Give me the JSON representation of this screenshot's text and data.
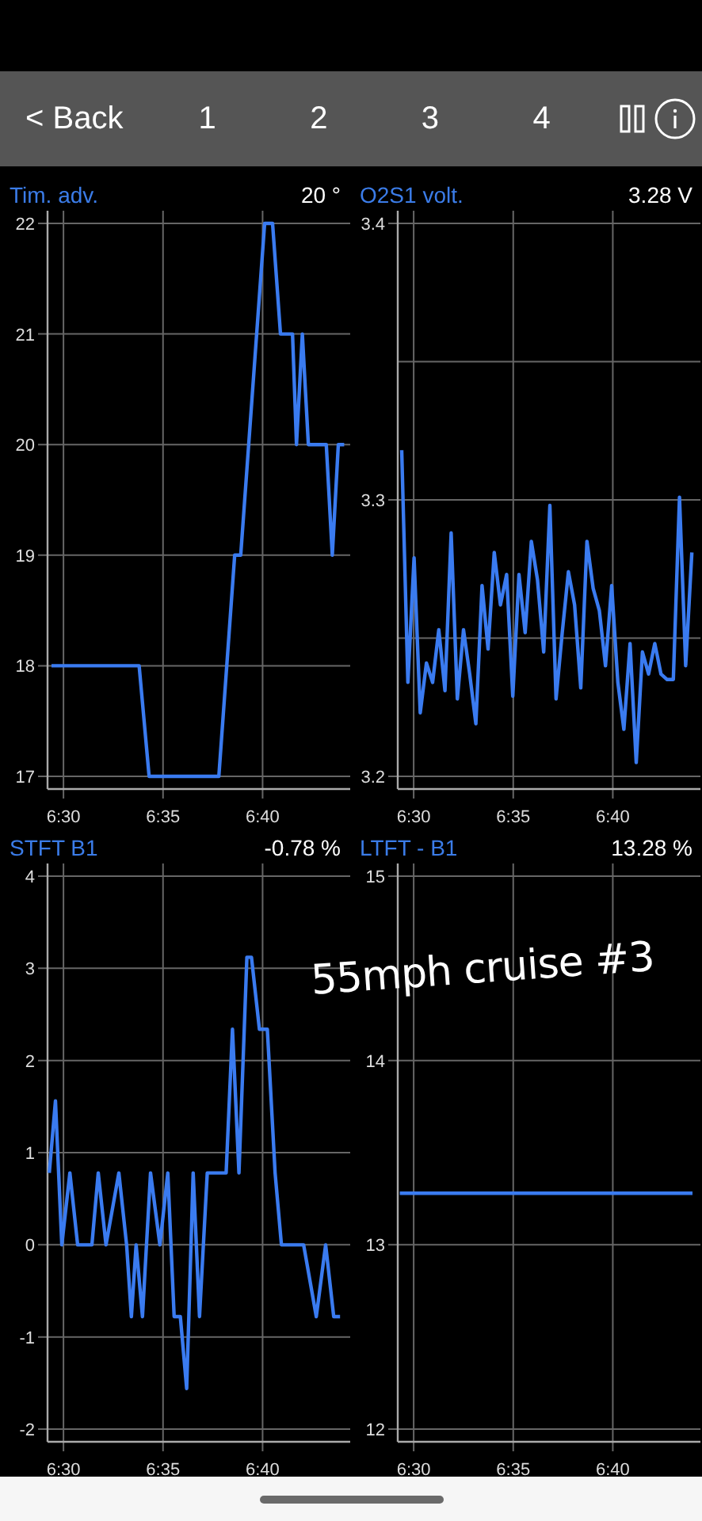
{
  "toolbar": {
    "back": "< Back",
    "pages": [
      "1",
      "2",
      "3",
      "4"
    ]
  },
  "panels": [
    {
      "title": "Tim. adv.",
      "reading": "20 °",
      "chart_data": {
        "type": "line",
        "x": [
          389.4,
          393.8,
          394.3,
          397.8,
          398.6,
          398.9,
          400.1,
          400.5,
          400.9,
          401.5,
          401.7,
          402.0,
          402.3,
          403.2,
          403.5,
          403.8,
          404.1
        ],
        "series": [
          {
            "color": "#3a7bf0",
            "values": [
              18,
              18,
              17,
              17,
              19,
              19,
              22,
              22,
              21,
              21,
              20,
              21,
              20,
              20,
              19,
              20,
              20
            ]
          }
        ],
        "grid": true,
        "xlim": [
          389.2,
          404.4
        ],
        "ylim": [
          17,
          22
        ],
        "xticks": [
          {
            "value": 390,
            "label": "6:30"
          },
          {
            "value": 395,
            "label": "6:35"
          },
          {
            "value": 400,
            "label": "6:40"
          }
        ],
        "yticks": [
          17,
          18,
          19,
          20,
          21,
          22
        ]
      }
    },
    {
      "title": "O2S1 volt.",
      "reading": "3.28 V",
      "chart_data": {
        "type": "line",
        "x": [
          389.4,
          389.71,
          390.02,
          390.33,
          390.64,
          390.95,
          391.26,
          391.57,
          391.88,
          392.19,
          392.5,
          392.81,
          393.12,
          393.43,
          393.74,
          394.05,
          394.36,
          394.67,
          394.98,
          395.29,
          395.6,
          395.91,
          396.22,
          396.53,
          396.84,
          397.15,
          397.46,
          397.77,
          398.08,
          398.39,
          398.7,
          399.01,
          399.32,
          399.63,
          399.94,
          400.25,
          400.56,
          400.87,
          401.18,
          401.49,
          401.8,
          402.11,
          402.42,
          402.73,
          403.04,
          403.35,
          403.66,
          403.97
        ],
        "series": [
          {
            "color": "#3a7bf0",
            "values": [
              3.318,
              3.234,
              3.279,
              3.223,
              3.241,
              3.234,
              3.253,
              3.231,
              3.288,
              3.228,
              3.253,
              3.237,
              3.219,
              3.269,
              3.246,
              3.281,
              3.262,
              3.273,
              3.229,
              3.273,
              3.252,
              3.285,
              3.271,
              3.245,
              3.298,
              3.228,
              3.252,
              3.274,
              3.262,
              3.232,
              3.285,
              3.268,
              3.26,
              3.24,
              3.269,
              3.234,
              3.217,
              3.248,
              3.205,
              3.245,
              3.237,
              3.248,
              3.237,
              3.235,
              3.235,
              3.301,
              3.24,
              3.281
            ]
          }
        ],
        "grid": true,
        "xlim": [
          389.2,
          404.4
        ],
        "ylim": [
          3.2,
          3.4
        ],
        "xticks": [
          {
            "value": 390,
            "label": "6:30"
          },
          {
            "value": 395,
            "label": "6:35"
          },
          {
            "value": 400,
            "label": "6:40"
          }
        ],
        "yticks": [
          3.2,
          3.3,
          3.4
        ],
        "ref_lines": [
          {
            "axis": "y",
            "value": 3.25
          },
          {
            "axis": "y",
            "value": 3.35
          }
        ]
      }
    },
    {
      "title": "STFT B1",
      "reading": "-0.78 %",
      "chart_data": {
        "type": "line",
        "x": [
          389.29,
          389.6,
          389.92,
          390.32,
          390.71,
          391.43,
          391.75,
          392.14,
          392.78,
          393.17,
          393.41,
          393.65,
          393.97,
          394.37,
          394.84,
          395.24,
          395.56,
          395.87,
          396.19,
          396.51,
          396.83,
          397.22,
          398.17,
          398.49,
          398.81,
          399.21,
          399.44,
          399.84,
          400.24,
          400.63,
          400.95,
          402.06,
          402.7,
          403.17,
          403.57,
          403.89
        ],
        "series": [
          {
            "color": "#3a7bf0",
            "values": [
              0.78,
              1.56,
              0,
              0.78,
              0,
              0,
              0.78,
              0,
              0.78,
              0,
              -0.78,
              0,
              -0.78,
              0.78,
              0,
              0.78,
              -0.78,
              -0.78,
              -1.56,
              0.78,
              -0.78,
              0.78,
              0.78,
              2.34,
              0.78,
              3.12,
              3.12,
              2.34,
              2.34,
              0.78,
              0,
              0,
              -0.78,
              0,
              -0.78,
              -0.78
            ]
          }
        ],
        "grid": true,
        "xlim": [
          389.2,
          404.4
        ],
        "ylim": [
          -2,
          4
        ],
        "xticks": [
          {
            "value": 390,
            "label": "6:30"
          },
          {
            "value": 395,
            "label": "6:35"
          },
          {
            "value": 400,
            "label": "6:40"
          }
        ],
        "yticks": [
          -2,
          -1,
          0,
          1,
          2,
          3,
          4
        ]
      }
    },
    {
      "title": "LTFT - B1",
      "reading": "13.28 %",
      "chart_data": {
        "type": "line",
        "x": [
          389.3,
          404.0
        ],
        "series": [
          {
            "color": "#3a7bf0",
            "values": [
              13.28,
              13.28
            ]
          }
        ],
        "grid": true,
        "xlim": [
          389.2,
          404.4
        ],
        "ylim": [
          12,
          15
        ],
        "xticks": [
          {
            "value": 390,
            "label": "6:30"
          },
          {
            "value": 395,
            "label": "6:35"
          },
          {
            "value": 400,
            "label": "6:40"
          }
        ],
        "yticks": [
          12,
          13,
          14,
          15
        ]
      }
    }
  ],
  "annotation": "55mph cruise #3"
}
